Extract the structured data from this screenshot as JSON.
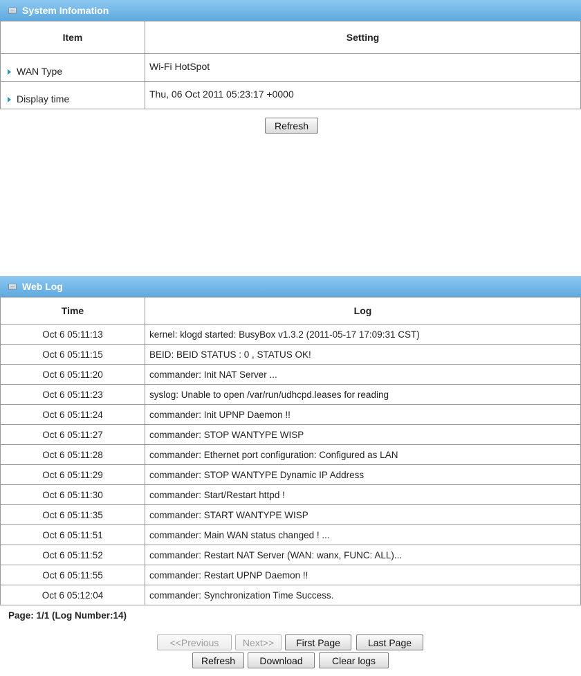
{
  "system_info": {
    "title": "System Infomation",
    "col_item": "Item",
    "col_setting": "Setting",
    "rows": [
      {
        "label": "WAN Type",
        "value": "Wi-Fi HotSpot"
      },
      {
        "label": "Display time",
        "value": "Thu, 06 Oct 2011 05:23:17 +0000"
      }
    ],
    "refresh_label": "Refresh"
  },
  "web_log": {
    "title": "Web Log",
    "col_time": "Time",
    "col_log": "Log",
    "entries": [
      {
        "time": "Oct 6 05:11:13",
        "log": "kernel: klogd started: BusyBox v1.3.2 (2011-05-17 17:09:31 CST)"
      },
      {
        "time": "Oct 6 05:11:15",
        "log": "BEID: BEID STATUS : 0 , STATUS OK!"
      },
      {
        "time": "Oct 6 05:11:20",
        "log": "commander: Init NAT Server ..."
      },
      {
        "time": "Oct 6 05:11:23",
        "log": "syslog: Unable to open /var/run/udhcpd.leases for reading"
      },
      {
        "time": "Oct 6 05:11:24",
        "log": "commander: Init UPNP Daemon !!"
      },
      {
        "time": "Oct 6 05:11:27",
        "log": "commander: STOP WANTYPE WISP"
      },
      {
        "time": "Oct 6 05:11:28",
        "log": "commander: Ethernet port configuration: Configured as LAN"
      },
      {
        "time": "Oct 6 05:11:29",
        "log": "commander: STOP WANTYPE Dynamic IP Address"
      },
      {
        "time": "Oct 6 05:11:30",
        "log": "commander: Start/Restart httpd !"
      },
      {
        "time": "Oct 6 05:11:35",
        "log": "commander: START WANTYPE WISP"
      },
      {
        "time": "Oct 6 05:11:51",
        "log": "commander: Main WAN status changed ! ..."
      },
      {
        "time": "Oct 6 05:11:52",
        "log": "commander: Restart NAT Server (WAN: wanx, FUNC: ALL)..."
      },
      {
        "time": "Oct 6 05:11:55",
        "log": "commander: Restart UPNP Daemon !!"
      },
      {
        "time": "Oct 6 05:12:04",
        "log": "commander: Synchronization Time Success."
      }
    ],
    "page_info": "Page: 1/1 (Log Number:14)",
    "buttons": {
      "previous": "<<Previous",
      "next": "Next>>",
      "first_page": "First Page",
      "last_page": "Last Page",
      "refresh": "Refresh",
      "download": "Download",
      "clear_logs": "Clear logs"
    }
  }
}
